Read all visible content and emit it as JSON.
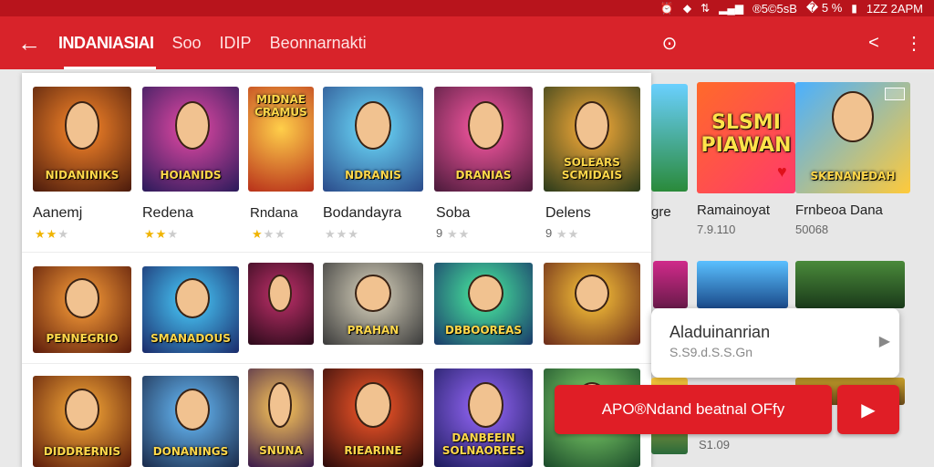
{
  "status_bar": {
    "icons": [
      "alarm-icon",
      "wifi-icon",
      "data-icon",
      "signal-icon"
    ],
    "network": "®5©5sB",
    "extra": "� 5 %",
    "battery_icon": "battery-icon",
    "time": "1ZZ 2APM"
  },
  "app_bar": {
    "tabs": [
      {
        "label": "INDANIASIAI"
      },
      {
        "label": "Soo"
      },
      {
        "label": "IDIP"
      },
      {
        "label": "Beonnarnakti"
      }
    ],
    "search_icon": "search-icon",
    "share_icon": "share-icon",
    "more_icon": "more-vert-icon"
  },
  "grid": {
    "row1": [
      {
        "title": "Aanemj",
        "stars": 2,
        "art": "NIDANINIKS"
      },
      {
        "title": "Redena",
        "stars": 2,
        "art": "HOIANIDS"
      },
      {
        "title": "Rndana",
        "stars": 1,
        "art": "MIDNAE CRAMUS"
      },
      {
        "title": "Bodandayra",
        "stars": 0,
        "art": "NDRANIS"
      },
      {
        "title": "Soba",
        "stars": 0,
        "meta": "9",
        "art": "DRANIAS"
      },
      {
        "title": "Delens",
        "stars": 0,
        "meta": "9",
        "art": "SOLEARS SCMIDAIS"
      }
    ],
    "row2_art": [
      "PENNEGRIO",
      "SMANADOUS",
      "",
      "PRAHAN",
      "DBBOOREAS",
      ""
    ],
    "row3_art": [
      "DIDDRERNIS",
      "DONANINGS",
      "SNUNA",
      "RIEARINE",
      "DANBEEIN SOLNAOREES",
      ""
    ]
  },
  "right_section": {
    "partial_title": "gre",
    "feature_art": "SLSMI PIAWAN",
    "feature_art2": "SKENANEDAH",
    "items": [
      {
        "title": "Ramainoyat",
        "meta": "7.9.110"
      },
      {
        "title": "Frnbeoa Dana",
        "meta": "50068"
      }
    ],
    "bottom_meta": "S1.09"
  },
  "popup_card": {
    "title": "Aladuinanrian",
    "subtitle": "S.S9.d.S.S.Gn"
  },
  "cta": {
    "label": "APO®Ndand beatnal OFfy",
    "play_icon": "play-icon"
  },
  "colors": {
    "primary": "#d8232a",
    "status": "#b8141c",
    "star": "#f0b400"
  }
}
